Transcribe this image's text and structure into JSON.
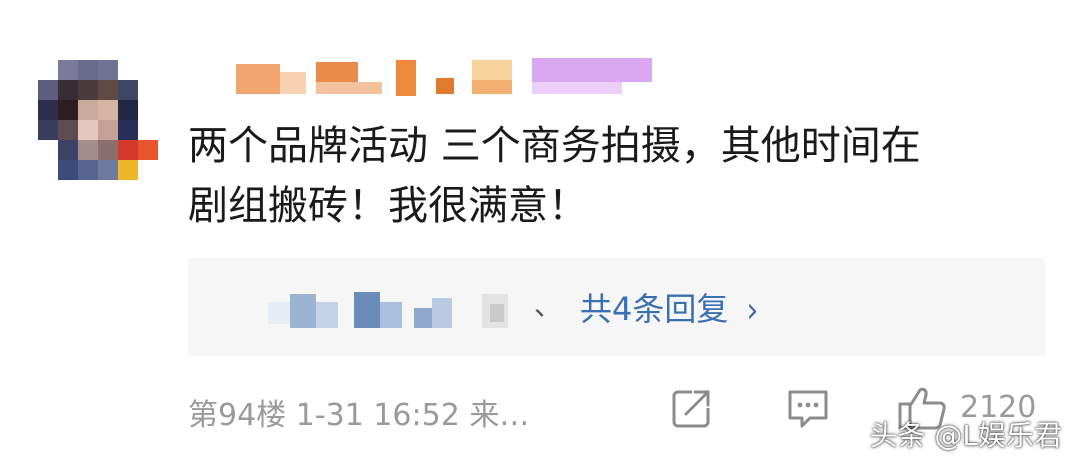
{
  "comment": {
    "line1": "两个品牌活动 三个商务拍摄，其他时间在",
    "line2": "剧组搬砖！我很满意！"
  },
  "replies": {
    "separator": "、",
    "link_label": "共4条回复",
    "chevron": "›"
  },
  "footer": {
    "meta": "第94楼 1-31 16:52 来…",
    "like_count": "2120"
  },
  "icons": {
    "share": "share-icon",
    "comment": "comment-icon",
    "like": "thumbs-up-icon"
  },
  "watermark": "头条 @L娱乐君",
  "colors": {
    "link": "#3a6fb0",
    "meta": "#9a9a9a",
    "text": "#1a1a1a",
    "reply_bg": "#f6f6f7"
  }
}
